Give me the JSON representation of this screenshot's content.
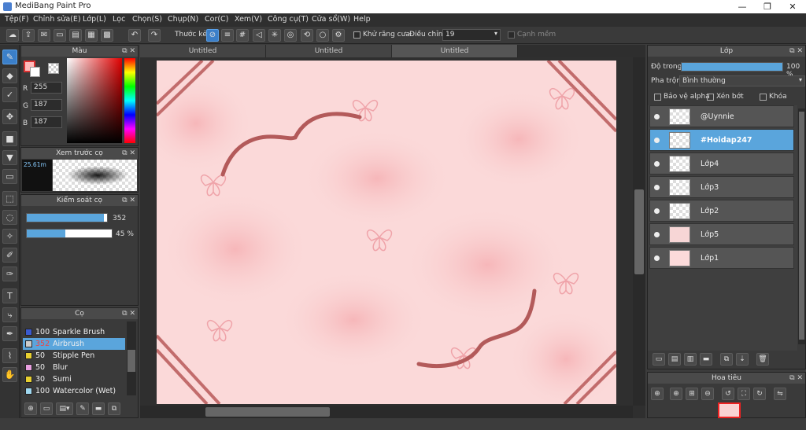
{
  "window": {
    "title": "MediBang Paint Pro",
    "minimize": "—",
    "maximize": "❐",
    "close": "✕"
  },
  "menu": [
    "Tệp(F)",
    "Chỉnh sửa(E)",
    "Lớp(L)",
    "Lọc",
    "Chọn(S)",
    "Chụp(N)",
    "Cor(C)",
    "Xem(V)",
    "Công cụ(T)",
    "Cửa sổ(W)",
    "Help"
  ],
  "toolbar": {
    "ruler_label": "Thước kẻ",
    "antialias_label": "Khử răng cưa",
    "correction_label": "Điều chỉnh",
    "correction_value": "19",
    "smooth_label": "Cạnh mềm"
  },
  "tabs": [
    "Untitled",
    "Untitled",
    "Untitled"
  ],
  "color_panel": {
    "title": "Màu",
    "r_label": "R",
    "r_value": "255",
    "g_label": "G",
    "g_value": "187",
    "b_label": "B",
    "b_value": "187",
    "fg_color": "#ffbbbb"
  },
  "brush_preview": {
    "title": "Xem trước cọ",
    "size": "25.61m"
  },
  "brush_control": {
    "title": "Kiểm soát cọ",
    "size_value": "352",
    "opacity_value": "45 %",
    "size_fraction": 0.96,
    "opacity_fraction": 0.45
  },
  "brush_panel": {
    "title": "Cọ",
    "items": [
      {
        "size": "100",
        "name": "Sparkle Brush",
        "color": "#3a5ad0",
        "selected": false
      },
      {
        "size": "352",
        "name": "Airbrush",
        "color": "#cccccc",
        "selected": true
      },
      {
        "size": "50",
        "name": "Stipple Pen",
        "color": "#e8d030",
        "selected": false
      },
      {
        "size": "50",
        "name": "Blur",
        "color": "#e8a0e0",
        "selected": false
      },
      {
        "size": "30",
        "name": "Sumi",
        "color": "#e8d030",
        "selected": false
      },
      {
        "size": "100",
        "name": "Watercolor (Wet)",
        "color": "#a0d8f0",
        "selected": false
      }
    ]
  },
  "layer_panel": {
    "title": "Lớp",
    "opacity_label": "Độ trong",
    "opacity_value": "100 %",
    "blend_label": "Pha trộn",
    "blend_value": "Bình thường",
    "protect_alpha": "Bảo vệ alpha",
    "clipping": "Xén bớt",
    "lock": "Khóa",
    "layers": [
      {
        "name": "@Uynnie",
        "selected": false
      },
      {
        "name": "#Hoidap247",
        "selected": true
      },
      {
        "name": "Lớp4",
        "selected": false
      },
      {
        "name": "Lớp3",
        "selected": false
      },
      {
        "name": "Lớp2",
        "selected": false
      },
      {
        "name": "Lớp5",
        "selected": false
      },
      {
        "name": "Lớp1",
        "selected": false
      }
    ]
  },
  "navigator": {
    "title": "Hoa tiêu"
  },
  "colors": {
    "accent": "#5aa5dc",
    "canvas": "#f9d3d3",
    "stroke": "#b35a5a"
  }
}
